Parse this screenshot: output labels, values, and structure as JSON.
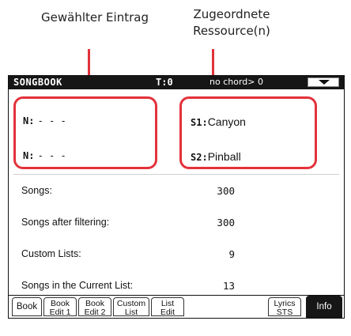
{
  "callouts": {
    "selected_entry": "Gewählter Eintrag",
    "assigned_resources": "Zugeordnete Ressource(n)"
  },
  "titlebar": {
    "title": "SONGBOOK",
    "tempo": "T:0",
    "chord": "no chord> 0",
    "dropdown_icon": "triangle-down-icon"
  },
  "entries": {
    "n1_key": "N:",
    "n1_value": "- - -",
    "n2_key": "N:",
    "n2_value": "- - -"
  },
  "resources": {
    "s1_key": "S1:",
    "s1_value": "Canyon",
    "s2_key": "S2:",
    "s2_value": "Pinball"
  },
  "info": [
    {
      "label": "Songs:",
      "value": "300"
    },
    {
      "label": "Songs after filtering:",
      "value": "300"
    },
    {
      "label": "Custom Lists:",
      "value": "9"
    },
    {
      "label": "Songs in the Current List:",
      "value": "13"
    }
  ],
  "tabs": {
    "book": "Book",
    "book_edit1_l1": "Book",
    "book_edit1_l2": "Edit 1",
    "book_edit2_l1": "Book",
    "book_edit2_l2": "Edit 2",
    "custom_list_l1": "Custom",
    "custom_list_l2": "List",
    "list_edit_l1": "List",
    "list_edit_l2": "Edit",
    "lyrics_l1": "Lyrics",
    "lyrics_l2": "STS",
    "info": "Info"
  },
  "colors": {
    "highlight": "#e3323b",
    "titlebar_bg": "#161616"
  }
}
